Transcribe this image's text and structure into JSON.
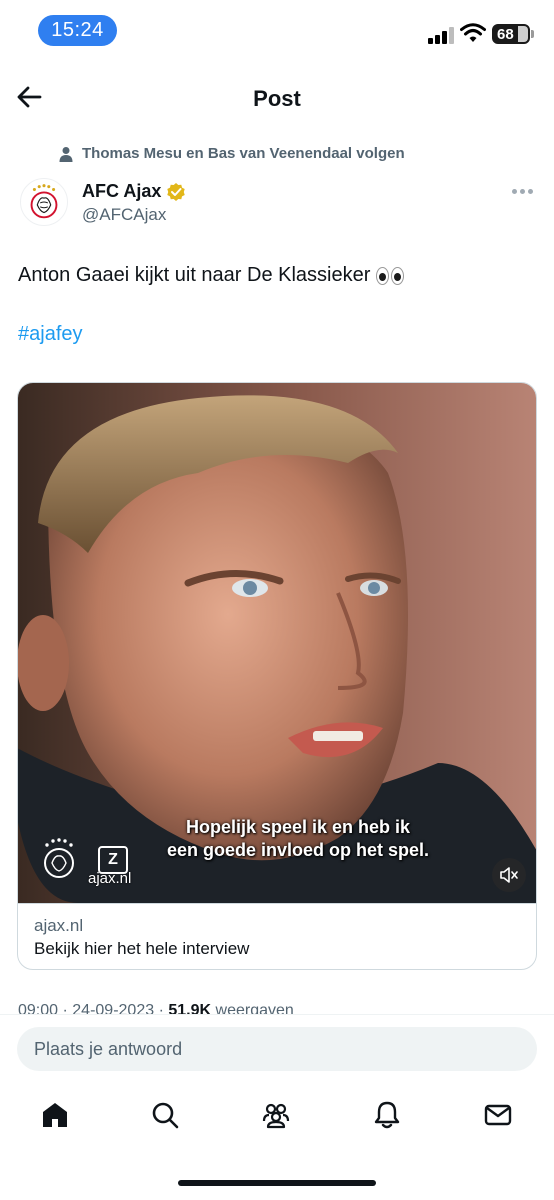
{
  "status_bar": {
    "time": "15:24",
    "battery": "68",
    "icons": [
      "signal-icon",
      "wifi-icon",
      "battery-icon"
    ]
  },
  "header": {
    "title": "Post",
    "back_icon": "arrow-left-icon"
  },
  "social_context": {
    "text": "Thomas Mesu en Bas van Veenendaal volgen",
    "icon": "person-icon"
  },
  "author": {
    "name": "AFC Ajax",
    "handle": "@AFCAjax",
    "verified_color": "#e2b719",
    "avatar_icon": "ajax-logo-icon"
  },
  "tweet": {
    "text": "Anton Gaaei kijkt uit naar De Klassieker",
    "emoji": "eyes-emoji",
    "hashtag": "#ajafey"
  },
  "card": {
    "subtitle_line1": "Hopelijk speel ik en heb ik",
    "subtitle_line2": "een goede invloed op het spel.",
    "overlay_logo": "Z",
    "overlay_domain": "ajax.nl",
    "mute_icon": "speaker-muted-icon",
    "domain": "ajax.nl",
    "headline": "Bekijk hier het hele interview"
  },
  "meta": {
    "time": "09:00",
    "date": "24-09-2023",
    "views_count": "51,9K",
    "views_label": "weergaven"
  },
  "reply": {
    "placeholder": "Plaats je antwoord"
  },
  "tab_bar": {
    "items": [
      "home-icon",
      "search-icon",
      "communities-icon",
      "notifications-icon",
      "messages-icon"
    ]
  },
  "colors": {
    "accent": "#1d9bf0",
    "time_pill": "#2f7ff0",
    "secondary_text": "#536471"
  }
}
